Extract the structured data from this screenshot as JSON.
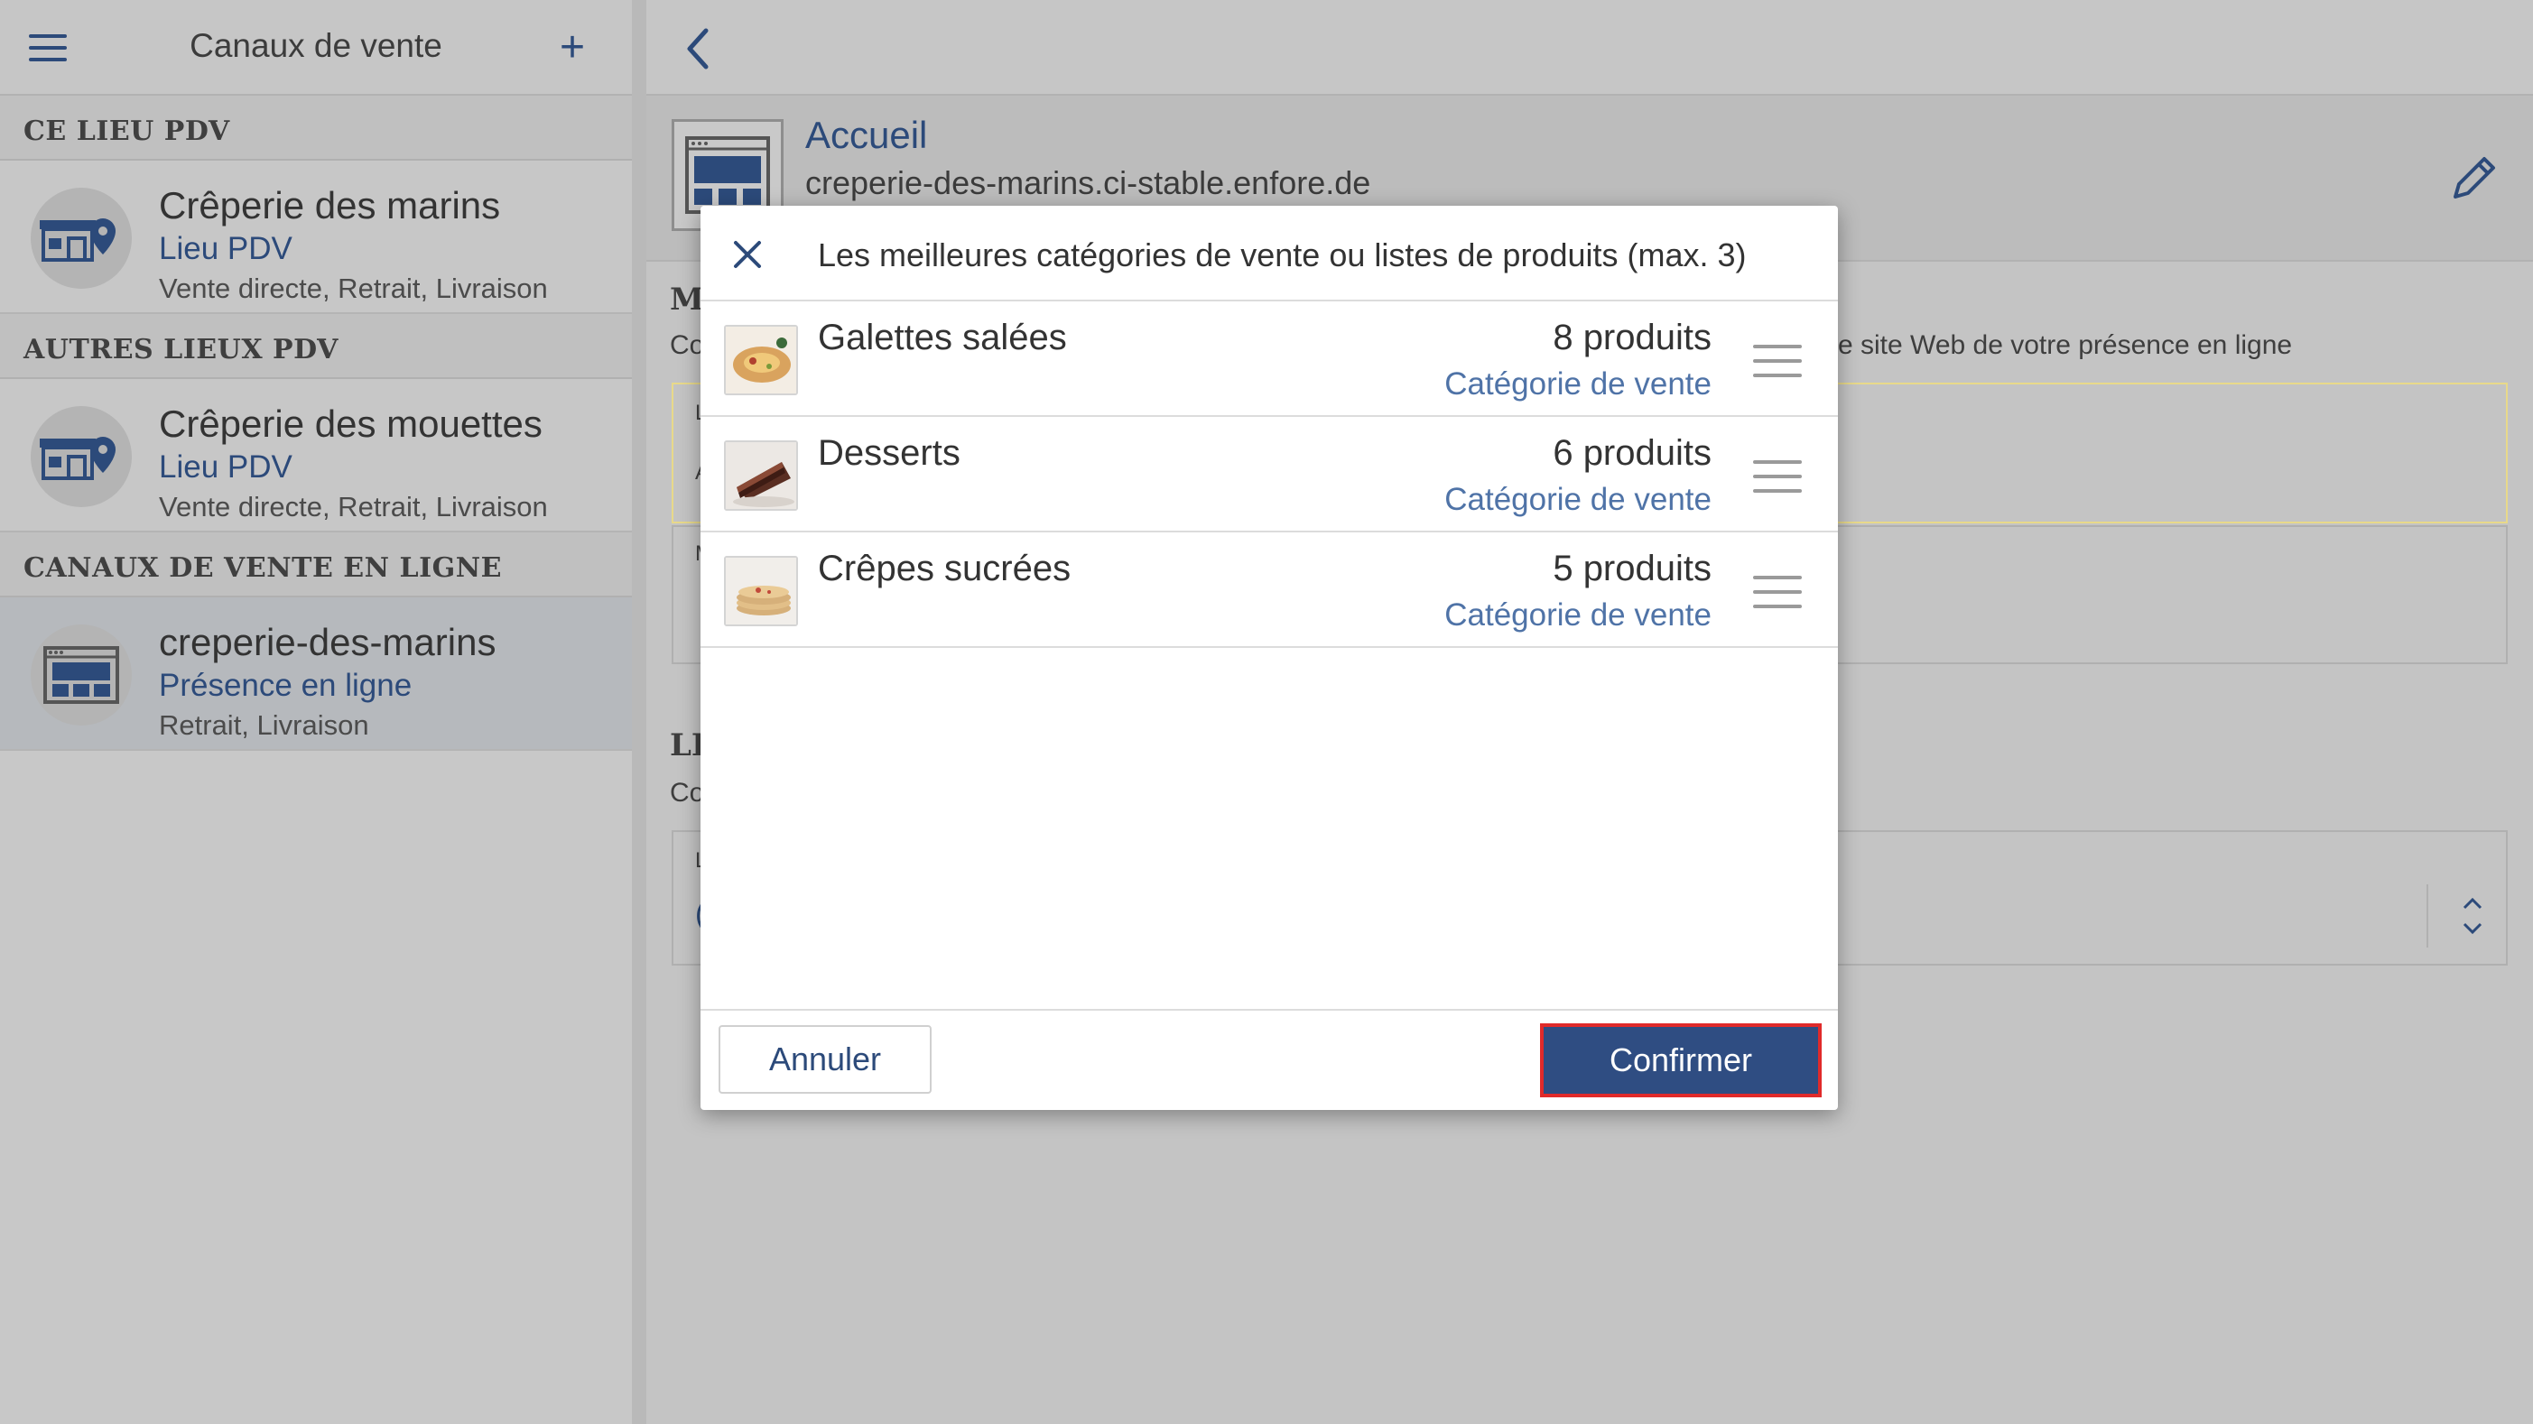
{
  "sidebar": {
    "title": "Canaux de vente",
    "sections": [
      {
        "header": "CE LIEU PDV"
      },
      {
        "header": "AUTRES LIEUX PDV"
      },
      {
        "header": "CANAUX DE VENTE EN LIGNE"
      }
    ],
    "items": [
      {
        "name": "Crêperie des marins",
        "type": "Lieu PDV",
        "modes": "Vente directe, Retrait, Livraison",
        "icon": "store-location-icon"
      },
      {
        "name": "Crêperie des mouettes",
        "type": "Lieu PDV",
        "modes": "Vente directe, Retrait, Livraison",
        "icon": "store-location-icon"
      },
      {
        "name": "creperie-des-marins",
        "type": "Présence en ligne",
        "modes": "Retrait, Livraison",
        "icon": "website-icon",
        "selected": true
      }
    ]
  },
  "main": {
    "title": "Accueil",
    "subtitle": "creperie-des-marins.ci-stable.enfore.de",
    "background_fragments": {
      "mo": "Mo",
      "co1": "Co",
      "site_text": "e site Web de votre présence en ligne",
      "l1": "L",
      "a1": "A",
      "m1": "M",
      "li": "LI",
      "co2": "Co",
      "l2": "L",
      "c": "("
    }
  },
  "modal": {
    "title": "Les meilleures catégories de vente ou listes de produits (max. 3)",
    "rows": [
      {
        "name": "Galettes salées",
        "count": "8 produits",
        "type": "Catégorie de vente",
        "thumb": "galette-thumb"
      },
      {
        "name": "Desserts",
        "count": "6 produits",
        "type": "Catégorie de vente",
        "thumb": "cake-thumb"
      },
      {
        "name": "Crêpes sucrées",
        "count": "5 produits",
        "type": "Catégorie de vente",
        "thumb": "crepes-thumb"
      }
    ],
    "cancel_label": "Annuler",
    "confirm_label": "Confirmer"
  },
  "colors": {
    "accent": "#2c4a7a",
    "link": "#4f73a7",
    "confirm_bg": "#2f4d82",
    "highlight_border": "#e02a2a",
    "warning_box_border": "#e8d98a"
  }
}
